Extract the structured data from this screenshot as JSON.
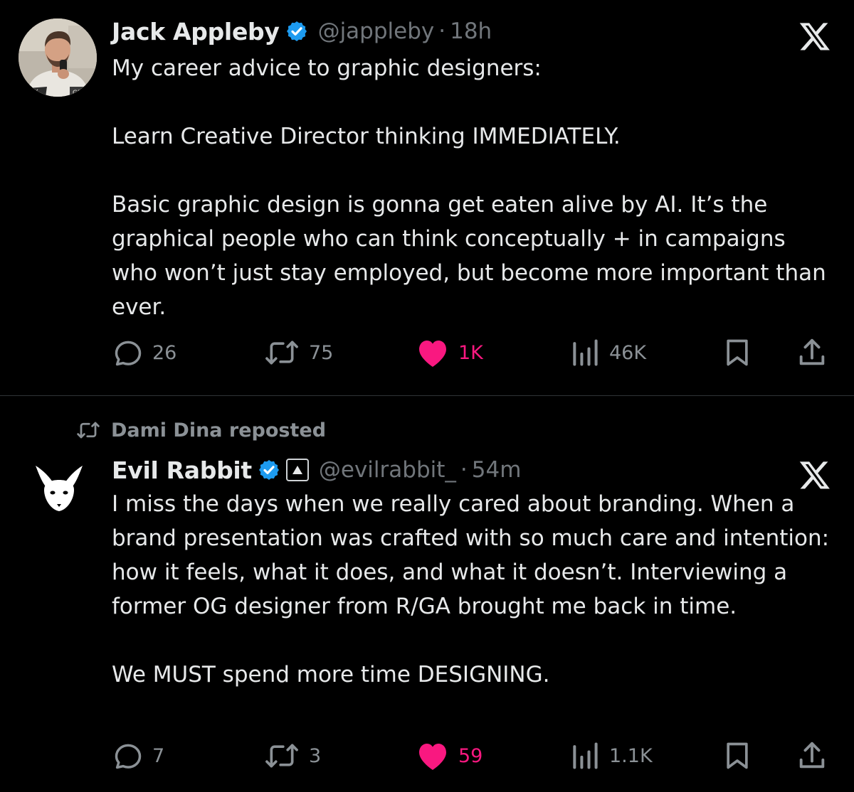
{
  "tweets": [
    {
      "author": {
        "name": "Jack Appleby",
        "handle": "@jappleby",
        "time": "18h",
        "verified": true
      },
      "body": [
        "My career advice to graphic designers:",
        "Learn Creative Director thinking IMMEDIATELY.",
        "Basic graphic design is gonna get eaten alive by AI. It’s the graphical people who can think conceptually + in campaigns who won’t just stay employed, but become more important than ever."
      ],
      "stats": {
        "replies": "26",
        "reposts": "75",
        "likes": "1K",
        "views": "46K"
      },
      "liked": true
    },
    {
      "repost_by": "Dami Dina reposted",
      "author": {
        "name": "Evil Rabbit",
        "handle": "@evilrabbit_",
        "time": "54m",
        "verified": true
      },
      "body": [
        "I miss the days when we really cared about branding. When a brand presentation was crafted with so much care and intention: how it feels, what it does, and what it doesn’t. Interviewing a former OG designer from R/GA brought me back in time.",
        "We MUST spend more time DESIGNING."
      ],
      "stats": {
        "replies": "7",
        "reposts": "3",
        "likes": "59",
        "views": "1.1K"
      },
      "liked": true
    }
  ],
  "colors": {
    "background": "#000000",
    "text": "#e7e9ea",
    "muted": "#71767b",
    "like": "#f91880",
    "verified": "#1d9bf0"
  },
  "icons": [
    "reply-icon",
    "repost-icon",
    "heart-icon",
    "views-icon",
    "bookmark-icon",
    "share-icon",
    "x-logo-icon",
    "verified-badge-icon",
    "affiliate-icon"
  ]
}
